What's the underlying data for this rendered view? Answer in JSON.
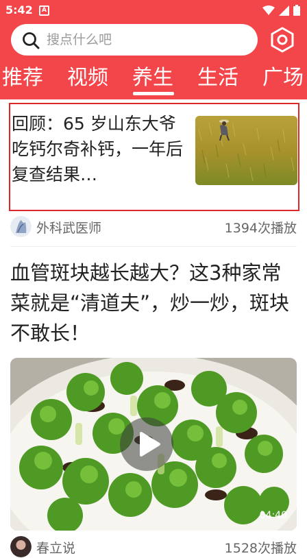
{
  "status_bar": {
    "time": "5:42",
    "notification_glyph": "A"
  },
  "search": {
    "placeholder": "搜点什么吧"
  },
  "tabs": [
    {
      "label": "推荐"
    },
    {
      "label": "视频"
    },
    {
      "label": "养生",
      "active": true
    },
    {
      "label": "生活"
    },
    {
      "label": "广场"
    }
  ],
  "feed": {
    "item1": {
      "title": "回顾：65 岁山东大爷吃钙尔奇补钙，一年后复查结果…",
      "author": "外科武医师",
      "plays": "1394次播放"
    },
    "item2": {
      "title": "血管斑块越长越大？这3种家常菜就是“清道夫”，炒一炒，斑块不敢长！",
      "duration": "04:40",
      "author": "春立说",
      "plays": "1528次播放"
    }
  },
  "colors": {
    "header": "#f2464a",
    "highlight_border": "#e0262b"
  }
}
